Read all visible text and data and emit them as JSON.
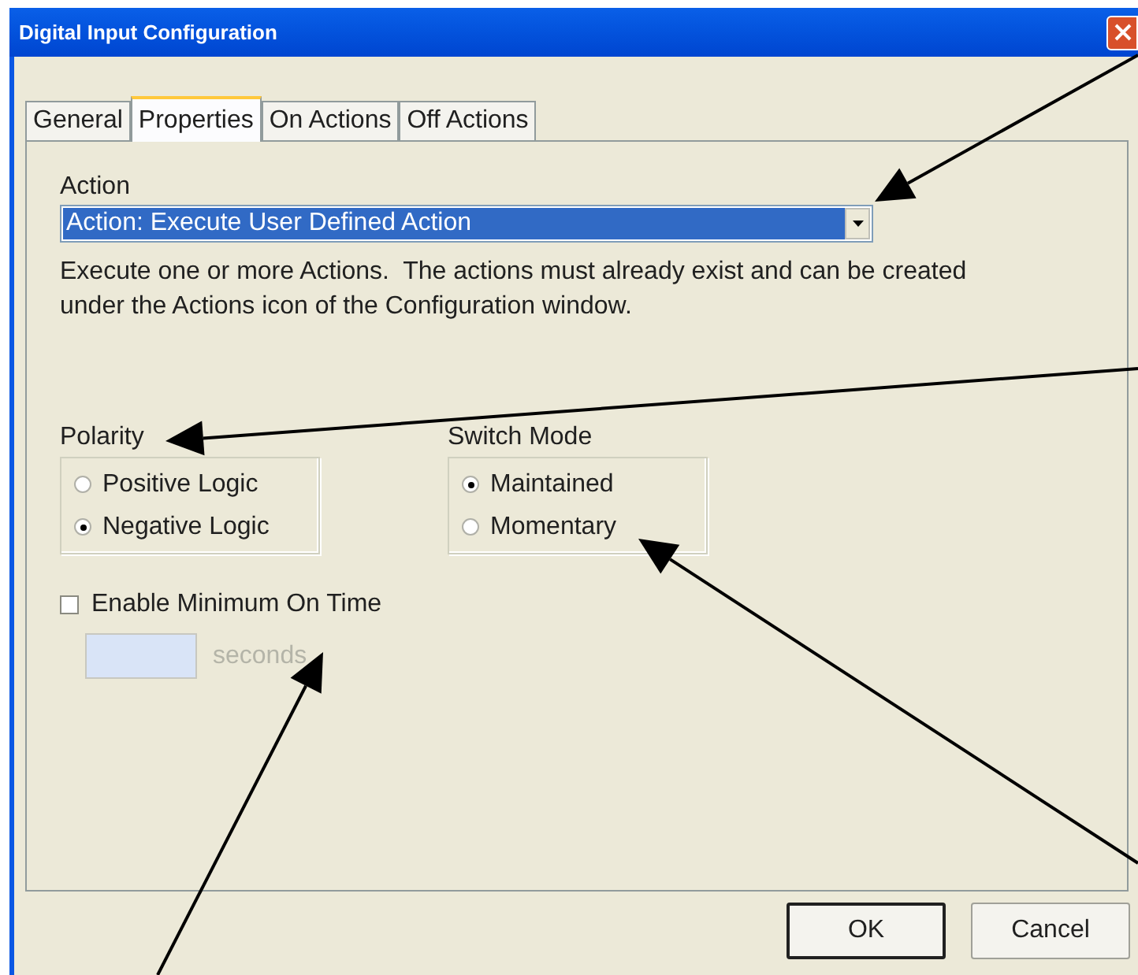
{
  "window": {
    "title": "Digital Input Configuration"
  },
  "tabs": [
    {
      "label": "General",
      "selected": false
    },
    {
      "label": "Properties",
      "selected": true
    },
    {
      "label": "On Actions",
      "selected": false
    },
    {
      "label": "Off Actions",
      "selected": false
    }
  ],
  "action": {
    "label": "Action",
    "value": "Action: Execute User Defined Action",
    "description": "Execute one or more Actions.  The actions must already exist and can be created under the Actions icon of the Configuration window."
  },
  "polarity": {
    "label": "Polarity",
    "options": [
      {
        "label": "Positive Logic",
        "selected": false
      },
      {
        "label": "Negative Logic",
        "selected": true
      }
    ]
  },
  "switch_mode": {
    "label": "Switch Mode",
    "options": [
      {
        "label": "Maintained",
        "selected": true
      },
      {
        "label": "Momentary",
        "selected": false
      }
    ]
  },
  "min_on_time": {
    "label": "Enable Minimum On Time",
    "checked": false,
    "disabled": true,
    "unit": "seconds"
  },
  "buttons": [
    {
      "label": "OK",
      "default": true
    },
    {
      "label": "Cancel",
      "default": false
    }
  ]
}
